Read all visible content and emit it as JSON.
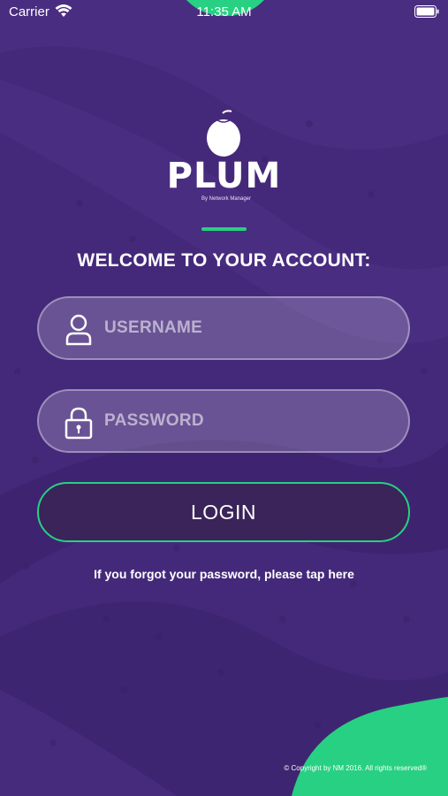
{
  "status_bar": {
    "carrier": "Carrier",
    "time": "11:35 AM",
    "wifi_icon": "wifi-icon",
    "battery_icon": "battery-icon"
  },
  "logo": {
    "icon": "plum-icon",
    "title": "PLUM",
    "subtitle": "By Network Manager"
  },
  "welcome_text": "WELCOME TO YOUR ACCOUNT:",
  "username": {
    "placeholder": "USERNAME",
    "value": "",
    "icon": "user-icon"
  },
  "password": {
    "placeholder": "PASSWORD",
    "value": "",
    "icon": "lock-icon"
  },
  "login_label": "LOGIN",
  "forgot_text": "If you forgot your password, please tap here",
  "copyright": "© Copyright by NM 2016. All rights reserved®",
  "colors": {
    "background": "#44297a",
    "accent_green": "#27d082",
    "button_fill": "#3a2459"
  }
}
